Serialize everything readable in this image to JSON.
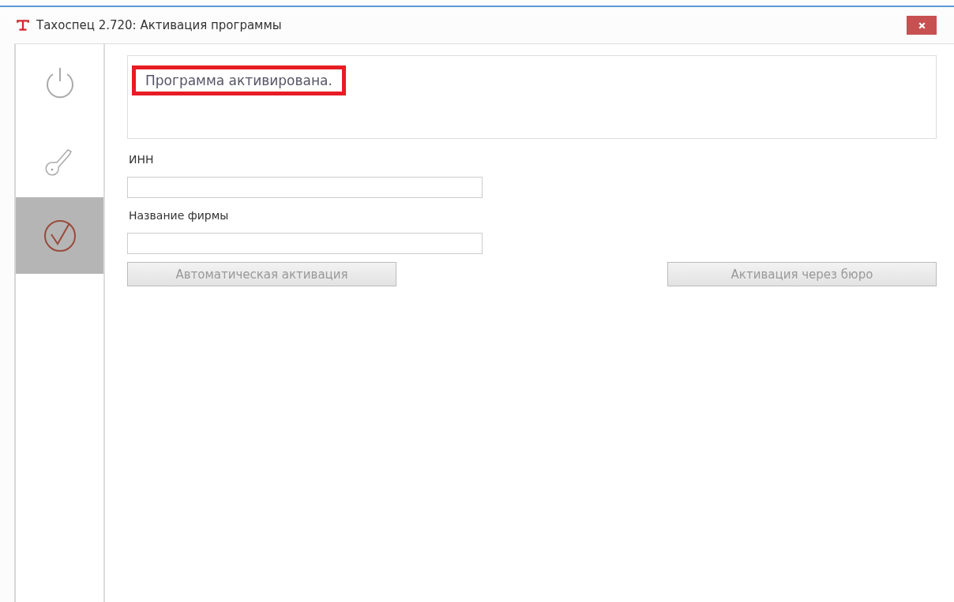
{
  "window": {
    "title": "Тахоспец 2.720: Активация программы"
  },
  "sidebar": {
    "items": [
      {
        "kind": "power",
        "selected": false
      },
      {
        "kind": "key",
        "selected": false
      },
      {
        "kind": "check",
        "selected": true
      }
    ]
  },
  "status": {
    "message": "Программа активирована.",
    "highlighted": true
  },
  "fields": [
    {
      "label": "ИНН"
    },
    {
      "label": "Название фирмы"
    }
  ],
  "buttons": [
    {
      "label": "Автоматическая активация",
      "disabled": true
    },
    {
      "label": "Активация через бюро",
      "disabled": true
    }
  ]
}
